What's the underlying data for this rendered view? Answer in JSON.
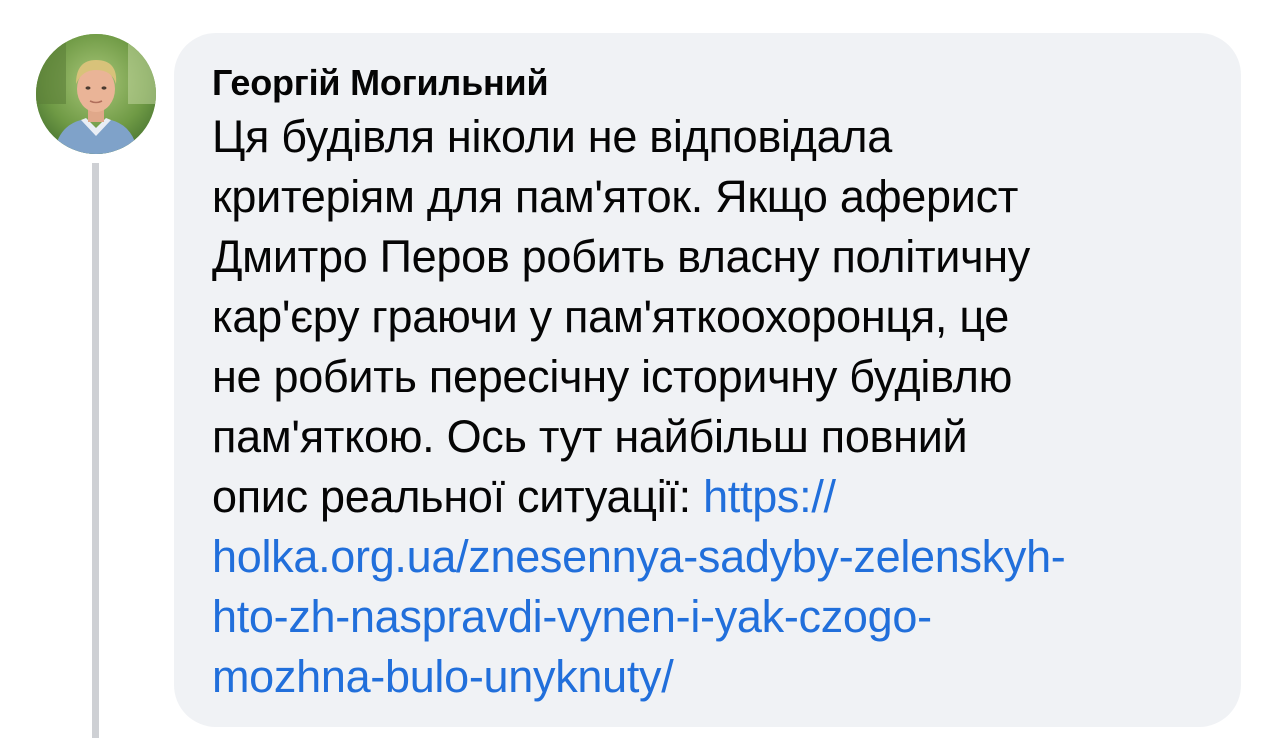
{
  "comment": {
    "author": "Георгій Могильний",
    "lines": [
      "Ця будівля ніколи не відповідала",
      "критеріям для пам'яток. Якщо аферист",
      "Дмитро Перов робить власну політичну",
      "кар'єру граючи у пам'яткоохоронця, це",
      "не робить пересічну історичну будівлю",
      "пам'яткою. Ось тут найбільш повний"
    ],
    "last_line_text": "опис реальної ситуації: ",
    "link_lines": [
      "https://",
      "holka.org.ua/znesennya-sadyby-zelenskyh-",
      "hto-zh-naspravdi-vynen-i-yak-czogo-",
      "mozhna-bulo-unyknuty/"
    ],
    "avatar_icon": "profile-photo"
  },
  "colors": {
    "bubble": "#f0f2f5",
    "text": "#050505",
    "link": "#216fdb",
    "thread_line": "#ced0d4"
  }
}
